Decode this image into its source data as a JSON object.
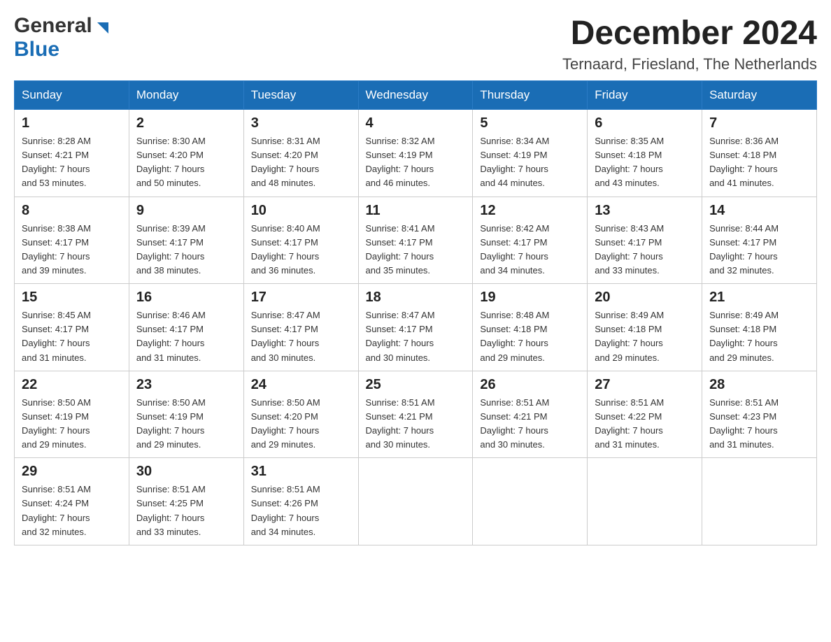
{
  "header": {
    "logo_general": "General",
    "logo_blue": "Blue",
    "month_title": "December 2024",
    "location": "Ternaard, Friesland, The Netherlands"
  },
  "days_of_week": [
    "Sunday",
    "Monday",
    "Tuesday",
    "Wednesday",
    "Thursday",
    "Friday",
    "Saturday"
  ],
  "weeks": [
    [
      {
        "day": "1",
        "sunrise": "8:28 AM",
        "sunset": "4:21 PM",
        "daylight": "7 hours and 53 minutes."
      },
      {
        "day": "2",
        "sunrise": "8:30 AM",
        "sunset": "4:20 PM",
        "daylight": "7 hours and 50 minutes."
      },
      {
        "day": "3",
        "sunrise": "8:31 AM",
        "sunset": "4:20 PM",
        "daylight": "7 hours and 48 minutes."
      },
      {
        "day": "4",
        "sunrise": "8:32 AM",
        "sunset": "4:19 PM",
        "daylight": "7 hours and 46 minutes."
      },
      {
        "day": "5",
        "sunrise": "8:34 AM",
        "sunset": "4:19 PM",
        "daylight": "7 hours and 44 minutes."
      },
      {
        "day": "6",
        "sunrise": "8:35 AM",
        "sunset": "4:18 PM",
        "daylight": "7 hours and 43 minutes."
      },
      {
        "day": "7",
        "sunrise": "8:36 AM",
        "sunset": "4:18 PM",
        "daylight": "7 hours and 41 minutes."
      }
    ],
    [
      {
        "day": "8",
        "sunrise": "8:38 AM",
        "sunset": "4:17 PM",
        "daylight": "7 hours and 39 minutes."
      },
      {
        "day": "9",
        "sunrise": "8:39 AM",
        "sunset": "4:17 PM",
        "daylight": "7 hours and 38 minutes."
      },
      {
        "day": "10",
        "sunrise": "8:40 AM",
        "sunset": "4:17 PM",
        "daylight": "7 hours and 36 minutes."
      },
      {
        "day": "11",
        "sunrise": "8:41 AM",
        "sunset": "4:17 PM",
        "daylight": "7 hours and 35 minutes."
      },
      {
        "day": "12",
        "sunrise": "8:42 AM",
        "sunset": "4:17 PM",
        "daylight": "7 hours and 34 minutes."
      },
      {
        "day": "13",
        "sunrise": "8:43 AM",
        "sunset": "4:17 PM",
        "daylight": "7 hours and 33 minutes."
      },
      {
        "day": "14",
        "sunrise": "8:44 AM",
        "sunset": "4:17 PM",
        "daylight": "7 hours and 32 minutes."
      }
    ],
    [
      {
        "day": "15",
        "sunrise": "8:45 AM",
        "sunset": "4:17 PM",
        "daylight": "7 hours and 31 minutes."
      },
      {
        "day": "16",
        "sunrise": "8:46 AM",
        "sunset": "4:17 PM",
        "daylight": "7 hours and 31 minutes."
      },
      {
        "day": "17",
        "sunrise": "8:47 AM",
        "sunset": "4:17 PM",
        "daylight": "7 hours and 30 minutes."
      },
      {
        "day": "18",
        "sunrise": "8:47 AM",
        "sunset": "4:17 PM",
        "daylight": "7 hours and 30 minutes."
      },
      {
        "day": "19",
        "sunrise": "8:48 AM",
        "sunset": "4:18 PM",
        "daylight": "7 hours and 29 minutes."
      },
      {
        "day": "20",
        "sunrise": "8:49 AM",
        "sunset": "4:18 PM",
        "daylight": "7 hours and 29 minutes."
      },
      {
        "day": "21",
        "sunrise": "8:49 AM",
        "sunset": "4:18 PM",
        "daylight": "7 hours and 29 minutes."
      }
    ],
    [
      {
        "day": "22",
        "sunrise": "8:50 AM",
        "sunset": "4:19 PM",
        "daylight": "7 hours and 29 minutes."
      },
      {
        "day": "23",
        "sunrise": "8:50 AM",
        "sunset": "4:19 PM",
        "daylight": "7 hours and 29 minutes."
      },
      {
        "day": "24",
        "sunrise": "8:50 AM",
        "sunset": "4:20 PM",
        "daylight": "7 hours and 29 minutes."
      },
      {
        "day": "25",
        "sunrise": "8:51 AM",
        "sunset": "4:21 PM",
        "daylight": "7 hours and 30 minutes."
      },
      {
        "day": "26",
        "sunrise": "8:51 AM",
        "sunset": "4:21 PM",
        "daylight": "7 hours and 30 minutes."
      },
      {
        "day": "27",
        "sunrise": "8:51 AM",
        "sunset": "4:22 PM",
        "daylight": "7 hours and 31 minutes."
      },
      {
        "day": "28",
        "sunrise": "8:51 AM",
        "sunset": "4:23 PM",
        "daylight": "7 hours and 31 minutes."
      }
    ],
    [
      {
        "day": "29",
        "sunrise": "8:51 AM",
        "sunset": "4:24 PM",
        "daylight": "7 hours and 32 minutes."
      },
      {
        "day": "30",
        "sunrise": "8:51 AM",
        "sunset": "4:25 PM",
        "daylight": "7 hours and 33 minutes."
      },
      {
        "day": "31",
        "sunrise": "8:51 AM",
        "sunset": "4:26 PM",
        "daylight": "7 hours and 34 minutes."
      },
      null,
      null,
      null,
      null
    ]
  ],
  "labels": {
    "sunrise": "Sunrise:",
    "sunset": "Sunset:",
    "daylight": "Daylight:"
  }
}
